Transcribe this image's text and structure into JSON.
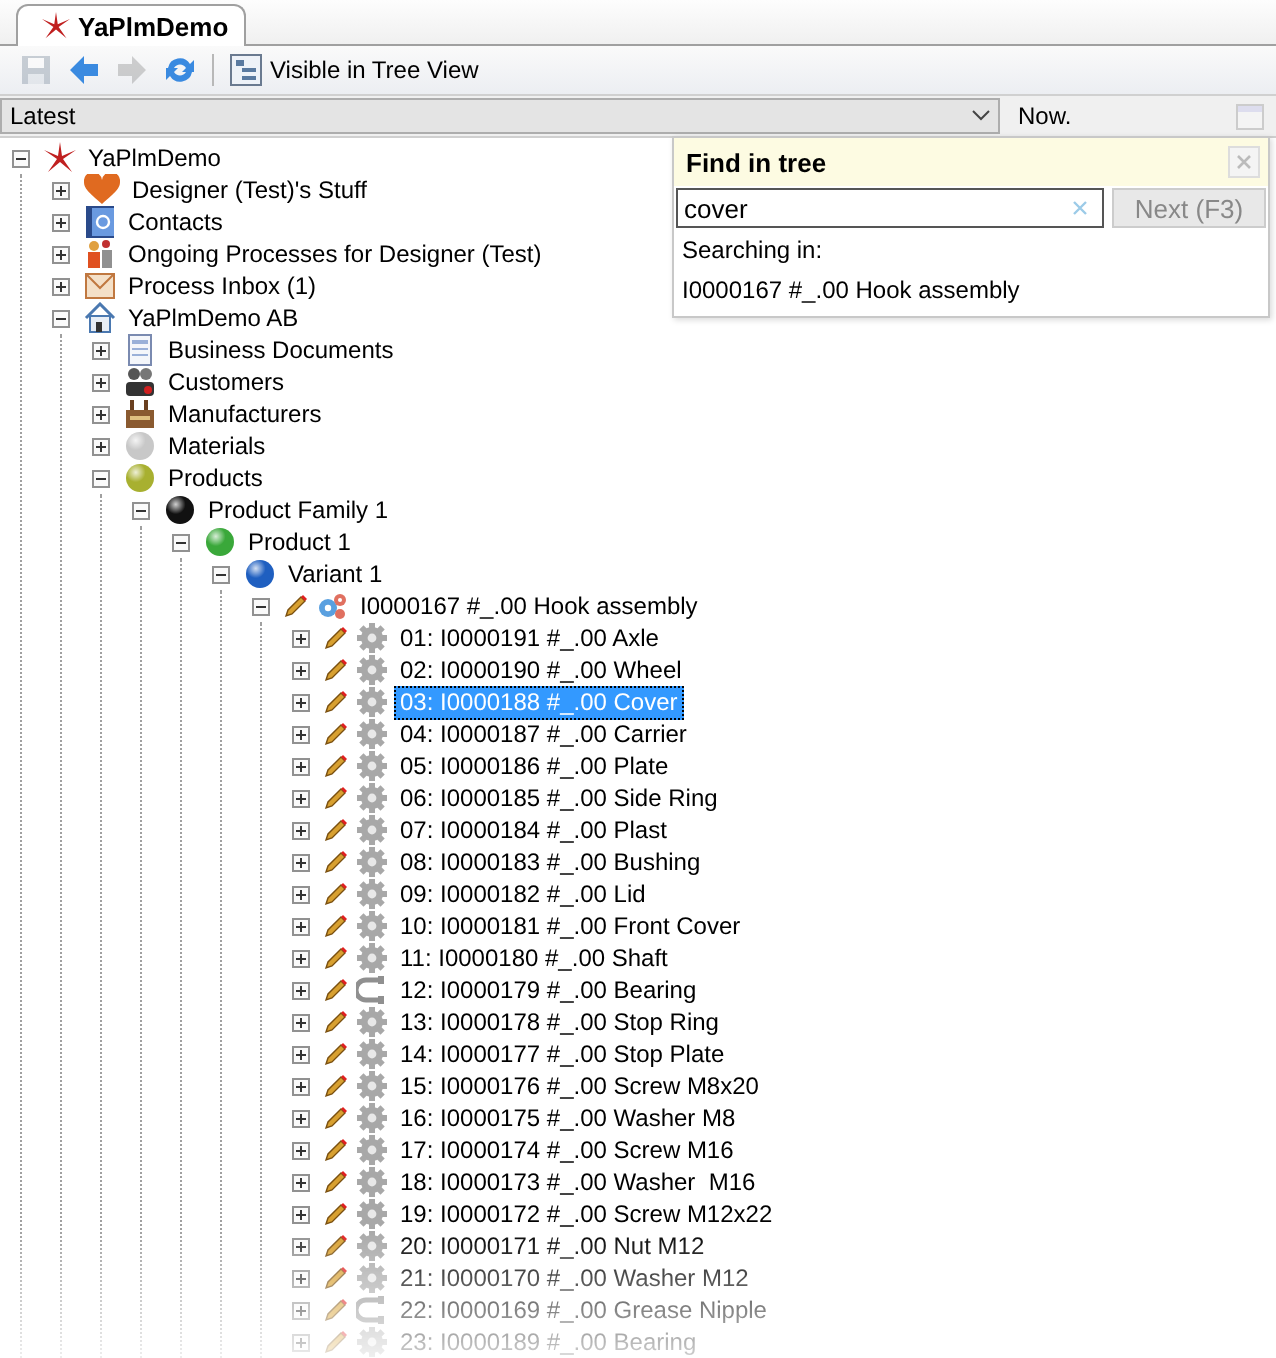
{
  "tab": {
    "title": "YaPlmDemo",
    "selected": true
  },
  "toolbar": [
    {
      "kind": "save",
      "disabled": true
    },
    {
      "kind": "back",
      "disabled": false
    },
    {
      "kind": "forward",
      "disabled": true
    },
    {
      "kind": "refresh",
      "disabled": false
    },
    {
      "kind": "tree-view",
      "label": "Visible in Tree View",
      "disabled": false
    }
  ],
  "filter": {
    "value": "Latest",
    "date_label": "Now."
  },
  "find_panel": {
    "title": "Find in tree",
    "search": {
      "value": "cover"
    },
    "next_button": {
      "label": "Next (F3)",
      "disabled": true
    },
    "searching_label": "Searching in:",
    "scope": "I0000167 #_.00 Hook assembly"
  },
  "tree": [
    {
      "label": "YaPlmDemo",
      "kind": "root",
      "expanded": true,
      "selected": false,
      "children": [
        {
          "label": "Designer (Test)'s Stuff",
          "kind": "heart",
          "expanded": false,
          "selected": false
        },
        {
          "label": "Contacts",
          "kind": "contacts",
          "expanded": false,
          "selected": false
        },
        {
          "label": "Ongoing Processes for Designer (Test)",
          "kind": "processes",
          "expanded": false,
          "selected": false
        },
        {
          "label": "Process Inbox (1)",
          "kind": "inbox",
          "expanded": false,
          "selected": false
        },
        {
          "label": "YaPlmDemo AB",
          "kind": "company",
          "expanded": true,
          "selected": false,
          "children": [
            {
              "label": "Business Documents",
              "kind": "document",
              "expanded": false,
              "selected": false
            },
            {
              "label": "Customers",
              "kind": "customers",
              "expanded": false,
              "selected": false
            },
            {
              "label": "Manufacturers",
              "kind": "factory",
              "expanded": false,
              "selected": false
            },
            {
              "label": "Materials",
              "kind": "sphere",
              "color": "#c8c8c8",
              "expanded": false,
              "selected": false
            },
            {
              "label": "Products",
              "kind": "sphere",
              "color": "#a8b030",
              "expanded": true,
              "selected": false,
              "children": [
                {
                  "label": "Product Family 1",
                  "kind": "sphere",
                  "color": "#111111",
                  "expanded": true,
                  "selected": false,
                  "children": [
                    {
                      "label": "Product 1",
                      "kind": "sphere",
                      "color": "#3aa83a",
                      "expanded": true,
                      "selected": false,
                      "children": [
                        {
                          "label": "Variant 1",
                          "kind": "sphere",
                          "color": "#1f5fc0",
                          "expanded": true,
                          "selected": false,
                          "children": [
                            {
                              "label": "I0000167 #_.00 Hook assembly",
                              "kind": "assembly",
                              "expanded": true,
                              "selected": false,
                              "children": [
                                {
                                  "label": "01: I0000191 #_.00 Axle",
                                  "kind": "part",
                                  "expanded": false,
                                  "selected": false
                                },
                                {
                                  "label": "02: I0000190 #_.00 Wheel",
                                  "kind": "part",
                                  "expanded": false,
                                  "selected": false
                                },
                                {
                                  "label": "03: I0000188 #_.00 Cover",
                                  "kind": "part",
                                  "expanded": false,
                                  "selected": true
                                },
                                {
                                  "label": "04: I0000187 #_.00 Carrier",
                                  "kind": "part",
                                  "expanded": false,
                                  "selected": false
                                },
                                {
                                  "label": "05: I0000186 #_.00 Plate",
                                  "kind": "part",
                                  "expanded": false,
                                  "selected": false
                                },
                                {
                                  "label": "06: I0000185 #_.00 Side Ring",
                                  "kind": "part",
                                  "expanded": false,
                                  "selected": false
                                },
                                {
                                  "label": "07: I0000184 #_.00 Plast",
                                  "kind": "part",
                                  "expanded": false,
                                  "selected": false
                                },
                                {
                                  "label": "08: I0000183 #_.00 Bushing",
                                  "kind": "part",
                                  "expanded": false,
                                  "selected": false
                                },
                                {
                                  "label": "09: I0000182 #_.00 Lid",
                                  "kind": "part",
                                  "expanded": false,
                                  "selected": false
                                },
                                {
                                  "label": "10: I0000181 #_.00 Front Cover",
                                  "kind": "part",
                                  "expanded": false,
                                  "selected": false
                                },
                                {
                                  "label": "11: I0000180 #_.00 Shaft",
                                  "kind": "part",
                                  "expanded": false,
                                  "selected": false
                                },
                                {
                                  "label": "12: I0000179 #_.00 Bearing",
                                  "kind": "bearing",
                                  "expanded": false,
                                  "selected": false
                                },
                                {
                                  "label": "13: I0000178 #_.00 Stop Ring",
                                  "kind": "part",
                                  "expanded": false,
                                  "selected": false
                                },
                                {
                                  "label": "14: I0000177 #_.00 Stop Plate",
                                  "kind": "part",
                                  "expanded": false,
                                  "selected": false
                                },
                                {
                                  "label": "15: I0000176 #_.00 Screw M8x20",
                                  "kind": "part",
                                  "expanded": false,
                                  "selected": false
                                },
                                {
                                  "label": "16: I0000175 #_.00 Washer M8",
                                  "kind": "part",
                                  "expanded": false,
                                  "selected": false
                                },
                                {
                                  "label": "17: I0000174 #_.00 Screw M16",
                                  "kind": "part",
                                  "expanded": false,
                                  "selected": false
                                },
                                {
                                  "label": "18: I0000173 #_.00 Washer  M16",
                                  "kind": "part",
                                  "expanded": false,
                                  "selected": false
                                },
                                {
                                  "label": "19: I0000172 #_.00 Screw M12x22",
                                  "kind": "part",
                                  "expanded": false,
                                  "selected": false
                                },
                                {
                                  "label": "20: I0000171 #_.00 Nut M12",
                                  "kind": "part",
                                  "expanded": false,
                                  "selected": false
                                },
                                {
                                  "label": "21: I0000170 #_.00 Washer M12",
                                  "kind": "part",
                                  "expanded": false,
                                  "selected": false
                                },
                                {
                                  "label": "22: I0000169 #_.00 Grease Nipple",
                                  "kind": "bearing",
                                  "expanded": false,
                                  "selected": false
                                },
                                {
                                  "label": "23: I0000189 #_.00 Bearing",
                                  "kind": "part",
                                  "expanded": false,
                                  "selected": false
                                }
                              ]
                            }
                          ]
                        }
                      ]
                    }
                  ]
                }
              ]
            }
          ]
        }
      ]
    }
  ]
}
